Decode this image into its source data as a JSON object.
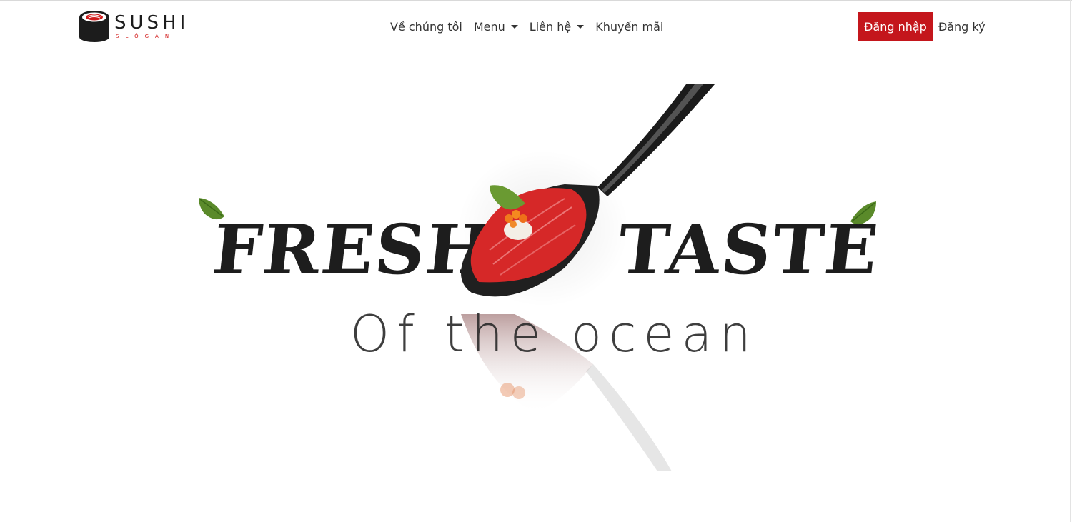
{
  "brand": {
    "name": "SUSHI",
    "slogan": "SLÔGAN",
    "logo_icon": "sushi-roll-icon"
  },
  "nav": {
    "items": [
      {
        "label": "Về chúng tôi",
        "dropdown": false
      },
      {
        "label": "Menu",
        "dropdown": true
      },
      {
        "label": "Liên hệ",
        "dropdown": true
      },
      {
        "label": "Khuyến mãi",
        "dropdown": false
      }
    ],
    "login_label": "Đăng nhập",
    "register_label": "Đăng ký"
  },
  "hero": {
    "headline_left": "FRESHE",
    "headline_right": "TASTE",
    "subheadline": "Of the ocean"
  },
  "colors": {
    "accent": "#c4161c",
    "text": "#1d1d1d",
    "background": "#ffffff"
  }
}
